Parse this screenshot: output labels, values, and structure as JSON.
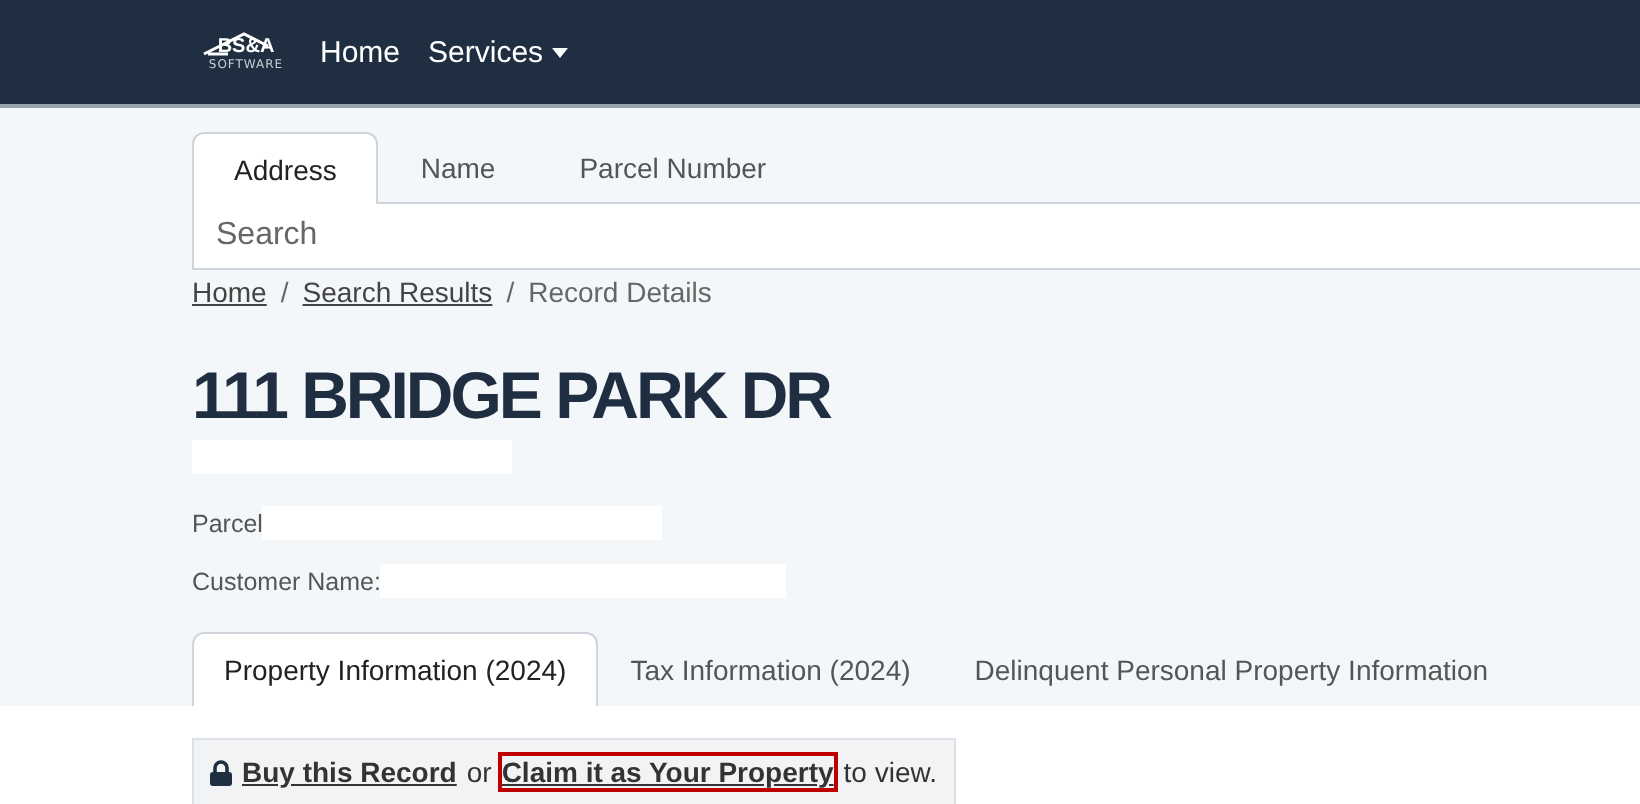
{
  "navbar": {
    "logo": {
      "text": "BS&A",
      "subtext": "SOFTWARE"
    },
    "links": [
      {
        "label": "Home",
        "dropdown": false
      },
      {
        "label": "Services",
        "dropdown": true
      }
    ]
  },
  "search_tabs": [
    {
      "label": "Address",
      "selected": true
    },
    {
      "label": "Name",
      "selected": false
    },
    {
      "label": "Parcel Number",
      "selected": false
    }
  ],
  "search": {
    "placeholder": "Search"
  },
  "breadcrumb": [
    {
      "kind": "link",
      "label": "Home"
    },
    {
      "kind": "separator",
      "label": "/"
    },
    {
      "kind": "link",
      "label": "Search Results"
    },
    {
      "kind": "separator",
      "label": "/"
    },
    {
      "kind": "current",
      "label": "Record Details"
    }
  ],
  "title": "111 BRIDGE PARK DR",
  "fields": [
    {
      "label": "Parcel"
    },
    {
      "label": "Customer Name:"
    }
  ],
  "record_tabs": [
    {
      "label": "Property Information (2024)",
      "selected": true
    },
    {
      "label": "Tax Information (2024)",
      "selected": false
    },
    {
      "label": "Delinquent Personal Property Information",
      "selected": false
    }
  ],
  "notice": {
    "parts": [
      {
        "kind": "link",
        "text": "Buy this Record",
        "highlighted": false
      },
      {
        "kind": "text",
        "text": "or"
      },
      {
        "kind": "link",
        "text": "Claim it as Your Property",
        "highlighted": true
      },
      {
        "kind": "text",
        "text": "to view."
      }
    ]
  }
}
